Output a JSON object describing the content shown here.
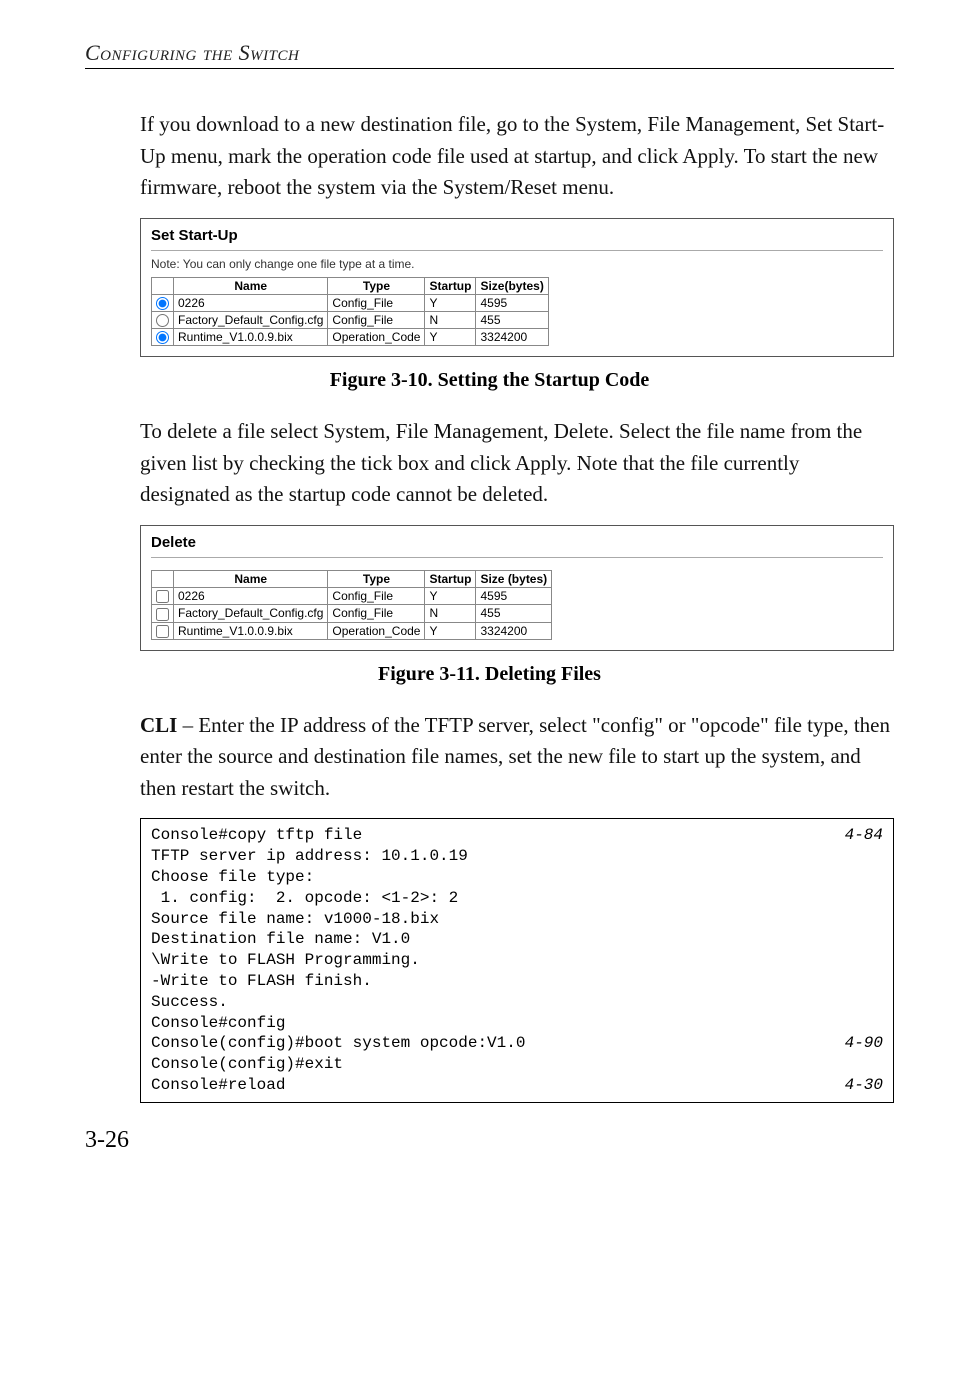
{
  "header": "Configuring the Switch",
  "para1": "If you download to a new destination file, go to the System, File Management, Set Start-Up menu, mark the operation code file used at startup, and click Apply. To start the new firmware, reboot the system via the System/Reset menu.",
  "figure1": {
    "title": "Set Start-Up",
    "note": "Note: You can only change one file type at a time.",
    "headers": [
      "",
      "Name",
      "Type",
      "Startup",
      "Size(bytes)"
    ],
    "rows": [
      {
        "sel": true,
        "name": "0226",
        "type": "Config_File",
        "startup": "Y",
        "size": "4595"
      },
      {
        "sel": false,
        "name": "Factory_Default_Config.cfg",
        "type": "Config_File",
        "startup": "N",
        "size": "455"
      },
      {
        "sel": true,
        "name": "Runtime_V1.0.0.9.bix",
        "type": "Operation_Code",
        "startup": "Y",
        "size": "3324200"
      }
    ]
  },
  "caption1": "Figure 3-10.  Setting the Startup Code",
  "para2": "To delete a file select System, File Management, Delete. Select the file name from the given list by checking the tick box and click Apply. Note that the file currently designated as the startup code cannot be deleted.",
  "figure2": {
    "title": "Delete",
    "headers": [
      "",
      "Name",
      "Type",
      "Startup",
      "Size (bytes)"
    ],
    "rows": [
      {
        "name": "0226",
        "type": "Config_File",
        "startup": "Y",
        "size": "4595"
      },
      {
        "name": "Factory_Default_Config.cfg",
        "type": "Config_File",
        "startup": "N",
        "size": "455"
      },
      {
        "name": "Runtime_V1.0.0.9.bix",
        "type": "Operation_Code",
        "startup": "Y",
        "size": "3324200"
      }
    ]
  },
  "caption2": "Figure 3-11.  Deleting Files",
  "para3a": "CLI",
  "para3b": " – Enter the IP address of the TFTP server, select \"config\" or \"opcode\" file type, then enter the source and destination file names, set the new file to start up the system, and then restart the switch.",
  "cli": [
    {
      "t": "Console#copy tftp file",
      "r": "4-84"
    },
    {
      "t": "TFTP server ip address: 10.1.0.19",
      "r": ""
    },
    {
      "t": "Choose file type:",
      "r": ""
    },
    {
      "t": " 1. config:  2. opcode: <1-2>: 2",
      "r": ""
    },
    {
      "t": "Source file name: v1000-18.bix",
      "r": ""
    },
    {
      "t": "Destination file name: V1.0",
      "r": ""
    },
    {
      "t": "\\Write to FLASH Programming.",
      "r": ""
    },
    {
      "t": "-Write to FLASH finish.",
      "r": ""
    },
    {
      "t": "Success.",
      "r": ""
    },
    {
      "t": "Console#config",
      "r": ""
    },
    {
      "t": "Console(config)#boot system opcode:V1.0",
      "r": "4-90"
    },
    {
      "t": "Console(config)#exit",
      "r": ""
    },
    {
      "t": "Console#reload",
      "r": "4-30"
    }
  ],
  "pagenum": "3-26"
}
